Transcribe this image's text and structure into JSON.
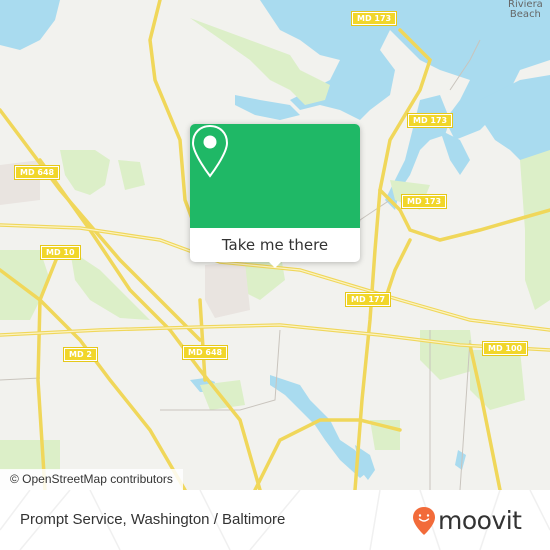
{
  "map": {
    "route_shields": [
      {
        "label": "MD 173"
      },
      {
        "label": "MD 173"
      },
      {
        "label": "MD 173"
      },
      {
        "label": "MD 648"
      },
      {
        "label": "MD 10"
      },
      {
        "label": "MD 177"
      },
      {
        "label": "MD 2"
      },
      {
        "label": "MD 648"
      },
      {
        "label": "MD 100"
      }
    ],
    "place_labels": [
      {
        "line1": "Riviera",
        "line2": "Beach"
      }
    ],
    "attribution": "© OpenStreetMap contributors",
    "colors": {
      "land": "#f2f2ee",
      "water": "#a9dbef",
      "park": "#dcefc8",
      "road": "#f3dc6b",
      "shield": "#f1d62a"
    }
  },
  "popup": {
    "icon": "map-pin-icon",
    "button_label": "Take me there",
    "color": "#1fb866"
  },
  "footer": {
    "place_name": "Prompt Service, Washington / Baltimore",
    "brand": {
      "icon": "moovit-smiley-pin-icon",
      "wordmark": "moovit",
      "color": "#f26b3a"
    }
  }
}
